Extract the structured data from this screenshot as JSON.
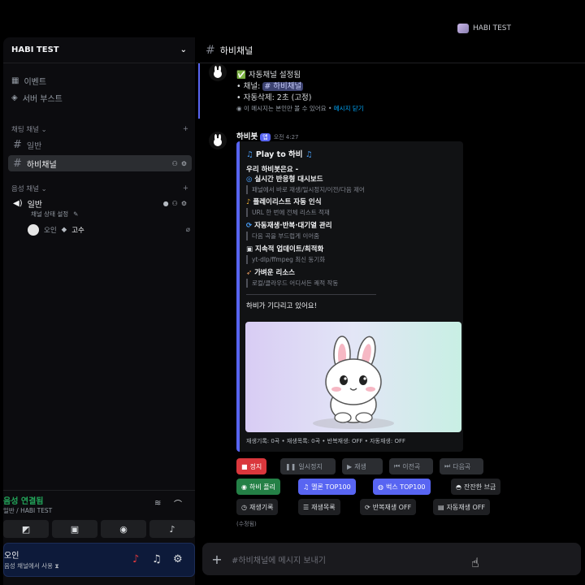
{
  "titlebar": {
    "server_name": "HABI TEST"
  },
  "sidebar": {
    "server_name": "HABI TEST",
    "events": "이벤트",
    "boost": "서버 부스트",
    "text_category": "채팅 채널",
    "text_channels": [
      "일반",
      "하비채널"
    ],
    "voice_category": "음성 채널",
    "voice_channel": "일반",
    "voice_status": "채널 상태 설정",
    "voice_user": "오인",
    "voice_user_badge": "고수",
    "voice_panel": {
      "title": "음성 연결됨",
      "subtitle": "일반 / HABI TEST"
    },
    "user": {
      "name": "오인",
      "status": "음성 채널에서 사용"
    }
  },
  "channel": {
    "name": "하비채널"
  },
  "message1": {
    "line1": "자동채널 설정됨",
    "line2_prefix": "• 채널: ",
    "line2_mention": "# 하비채널",
    "line3": "• 자동삭제: 2초 (고정)",
    "ephemeral": "이 메시지는 본인만 볼 수 있어요 •",
    "dismiss": "메시지 닫기"
  },
  "message2": {
    "author": "하비봇",
    "bot_tag": "앱",
    "time": "오전 4:27",
    "embed": {
      "title": "Play to 하비",
      "intro": "우리 하비봇은요 -",
      "features": [
        {
          "title": "실시간 반응형 대시보드",
          "desc": "패널에서 바로 재생/일시정지/이전/다음 제어"
        },
        {
          "title": "플레이리스트 자동 인식",
          "desc": "URL 한 번에 전체 리스트 적재"
        },
        {
          "title": "자동재생·반복·대기열 관리",
          "desc": "다음 곡을 부드럽게 이어줌"
        },
        {
          "title": "지속적 업데이트/최적화",
          "desc": "yt-dlp/ffmpeg 최신 동기화"
        },
        {
          "title": "가벼운 리소스",
          "desc": "로컬/클라우드 어디서든 쾌적 작동"
        }
      ],
      "closing": "하비가 기다리고 있어요!",
      "footer": "재생기록: 0곡 • 재생목록: 0곡 • 반복재생: OFF • 자동재생: OFF"
    },
    "row1": [
      "정지",
      "일시정지",
      "재생",
      "이전곡",
      "다음곡"
    ],
    "row2": [
      "하비 플리",
      "멜론 TOP100",
      "벅스 TOP100",
      "잔잔한 브금"
    ],
    "row3": [
      "재생기록",
      "재생목록",
      "반복재생 OFF",
      "자동재생 OFF"
    ],
    "edited": "(수정됨)"
  },
  "input": {
    "placeholder": "#하비채널에 메시지 보내기"
  }
}
